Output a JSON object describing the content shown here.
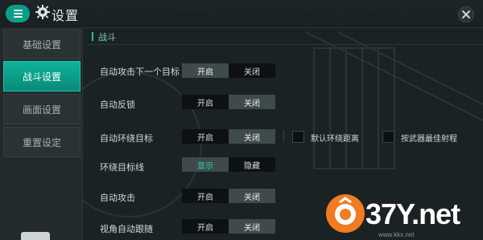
{
  "header": {
    "title": "设置"
  },
  "sidebar": {
    "items": [
      {
        "label": "基础设置",
        "active": false
      },
      {
        "label": "战斗设置",
        "active": true
      },
      {
        "label": "画面设置",
        "active": false
      },
      {
        "label": "重置设定",
        "active": false
      }
    ]
  },
  "section": {
    "title": "战斗"
  },
  "settings": [
    {
      "label": "自动攻击下一个目标",
      "on": "开启",
      "off": "关闭",
      "selected": "on"
    },
    {
      "label": "自动反锁",
      "on": "开启",
      "off": "关闭",
      "selected": "off"
    },
    {
      "label": "自动环绕目标",
      "on": "开启",
      "off": "关闭",
      "selected": "off"
    },
    {
      "label": "环绕目标线",
      "on": "显示",
      "off": "隐藏",
      "selected": "on"
    },
    {
      "label": "自动攻击",
      "on": "开启",
      "off": "关闭",
      "selected": "off"
    },
    {
      "label": "视角自动跟随",
      "on": "开启",
      "off": "关闭",
      "selected": "off"
    }
  ],
  "orbit_options": [
    {
      "label": "默认环绕距离",
      "checked": false
    },
    {
      "label": "按武器最佳射程",
      "checked": false
    }
  ],
  "watermark": {
    "text": "37Y.net",
    "sub": "www.kkx.net"
  },
  "colors": {
    "accent": "#0fb39b",
    "watermark": "#f07b22"
  }
}
